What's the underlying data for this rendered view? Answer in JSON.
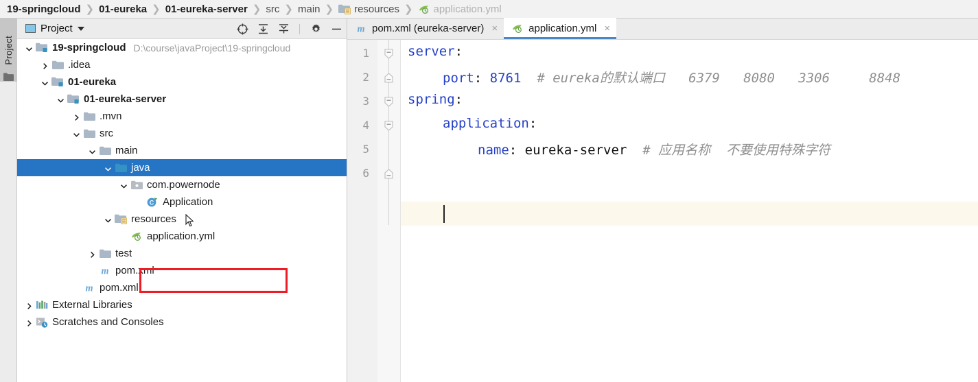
{
  "breadcrumb": {
    "items": [
      {
        "label": "19-springcloud",
        "style": "bold",
        "icon": null
      },
      {
        "label": "01-eureka",
        "style": "bold",
        "icon": null
      },
      {
        "label": "01-eureka-server",
        "style": "bold",
        "icon": null
      },
      {
        "label": "src",
        "style": "dim",
        "icon": null
      },
      {
        "label": "main",
        "style": "dim",
        "icon": null
      },
      {
        "label": "resources",
        "style": "dim",
        "icon": "resources-folder-icon"
      },
      {
        "label": "application.yml",
        "style": "ghost",
        "icon": "yaml-spring-file-icon"
      }
    ],
    "separator": "❯"
  },
  "tool_strip": {
    "tab_label": "Project",
    "folder_icon": "folder-icon"
  },
  "project_toolbar": {
    "title": "Project",
    "title_icon": "project-view-icon",
    "dropdown_icon": "chevron-down-icon",
    "buttons": [
      {
        "name": "select-opened-file-icon",
        "tooltip": "Select Opened File"
      },
      {
        "name": "expand-all-icon",
        "tooltip": "Expand All"
      },
      {
        "name": "collapse-all-icon",
        "tooltip": "Collapse All"
      },
      {
        "name": "settings-gear-icon",
        "tooltip": "Settings"
      },
      {
        "name": "hide-icon",
        "tooltip": "Hide"
      }
    ]
  },
  "tree": {
    "rows": [
      {
        "label": "19-springcloud",
        "path": "D:\\course\\javaProject\\19-springcloud",
        "indent": 0,
        "arrow": "expanded",
        "icon": "module-folder-icon",
        "bold": true,
        "selected": false
      },
      {
        "label": ".idea",
        "path": "",
        "indent": 1,
        "arrow": "collapsed",
        "icon": "folder-icon",
        "bold": false,
        "selected": false
      },
      {
        "label": "01-eureka",
        "path": "",
        "indent": 1,
        "arrow": "expanded",
        "icon": "module-folder-icon",
        "bold": true,
        "selected": false
      },
      {
        "label": "01-eureka-server",
        "path": "",
        "indent": 2,
        "arrow": "expanded",
        "icon": "module-folder-icon",
        "bold": true,
        "selected": false
      },
      {
        "label": ".mvn",
        "path": "",
        "indent": 3,
        "arrow": "collapsed",
        "icon": "folder-icon",
        "bold": false,
        "selected": false
      },
      {
        "label": "src",
        "path": "",
        "indent": 3,
        "arrow": "expanded",
        "icon": "folder-icon",
        "bold": false,
        "selected": false
      },
      {
        "label": "main",
        "path": "",
        "indent": 4,
        "arrow": "expanded",
        "icon": "folder-icon",
        "bold": false,
        "selected": false
      },
      {
        "label": "java",
        "path": "",
        "indent": 5,
        "arrow": "expanded",
        "icon": "source-folder-icon",
        "bold": false,
        "selected": true
      },
      {
        "label": "com.powernode",
        "path": "",
        "indent": 6,
        "arrow": "expanded",
        "icon": "package-icon",
        "bold": false,
        "selected": false
      },
      {
        "label": "Application",
        "path": "",
        "indent": 7,
        "arrow": "none",
        "icon": "spring-boot-class-icon",
        "bold": false,
        "selected": false
      },
      {
        "label": "resources",
        "path": "",
        "indent": 5,
        "arrow": "expanded",
        "icon": "resources-folder-icon",
        "bold": false,
        "selected": false
      },
      {
        "label": "application.yml",
        "path": "",
        "indent": 6,
        "arrow": "none",
        "icon": "yaml-spring-file-icon",
        "bold": false,
        "selected": false
      },
      {
        "label": "test",
        "path": "",
        "indent": 4,
        "arrow": "collapsed",
        "icon": "folder-icon",
        "bold": false,
        "selected": false
      },
      {
        "label": "pom.xml",
        "path": "",
        "indent": 4,
        "arrow": "none",
        "icon": "maven-file-icon",
        "bold": false,
        "selected": false
      },
      {
        "label": "pom.xml",
        "path": "",
        "indent": 3,
        "arrow": "none",
        "icon": "maven-file-icon",
        "bold": false,
        "selected": false
      },
      {
        "label": "External Libraries",
        "path": "",
        "indent": 0,
        "arrow": "collapsed",
        "icon": "libraries-icon",
        "bold": false,
        "selected": false
      },
      {
        "label": "Scratches and Consoles",
        "path": "",
        "indent": 0,
        "arrow": "collapsed",
        "icon": "scratches-icon",
        "bold": false,
        "selected": false
      }
    ],
    "highlight_box": {
      "target": "application.yml",
      "color": "#ee1c25"
    }
  },
  "editor": {
    "tabs": [
      {
        "label": "pom.xml (eureka-server)",
        "icon": "maven-file-icon",
        "active": false,
        "close_icon": "×"
      },
      {
        "label": "application.yml",
        "icon": "yaml-spring-file-icon",
        "active": true,
        "close_icon": "×"
      }
    ],
    "line_numbers": [
      "1",
      "2",
      "3",
      "4",
      "5",
      "6"
    ],
    "lines": [
      {
        "n": 1,
        "indent": 0,
        "key": "server",
        "colon": ":",
        "value": "",
        "comment": "",
        "fold": "expanded"
      },
      {
        "n": 2,
        "indent": 1,
        "key": "port",
        "colon": ":",
        "value": "8761",
        "value_type": "number",
        "comment": "# eureka的默认端口   6379   8080   3306     8848",
        "fold": "end"
      },
      {
        "n": 3,
        "indent": 0,
        "key": "spring",
        "colon": ":",
        "value": "",
        "comment": "",
        "fold": "expanded"
      },
      {
        "n": 4,
        "indent": 1,
        "key": "application",
        "colon": ":",
        "value": "",
        "comment": "",
        "fold": "expanded"
      },
      {
        "n": 5,
        "indent": 2,
        "key": "name",
        "colon": ":",
        "value": "eureka-server",
        "value_type": "string",
        "comment": "# 应用名称  不要使用特殊字符",
        "fold": "none"
      },
      {
        "n": 6,
        "indent": 0,
        "key": "",
        "colon": "",
        "value": "",
        "comment": "",
        "fold": "end",
        "caret": true
      }
    ]
  },
  "colors": {
    "selection_blue": "#2675c4",
    "yaml_key_blue": "#2541c8",
    "comment_gray": "#8f8f8f",
    "caret_line": "#fcf8ec",
    "annotation_red": "#ee1c25",
    "tab_underline": "#4a87c9"
  }
}
